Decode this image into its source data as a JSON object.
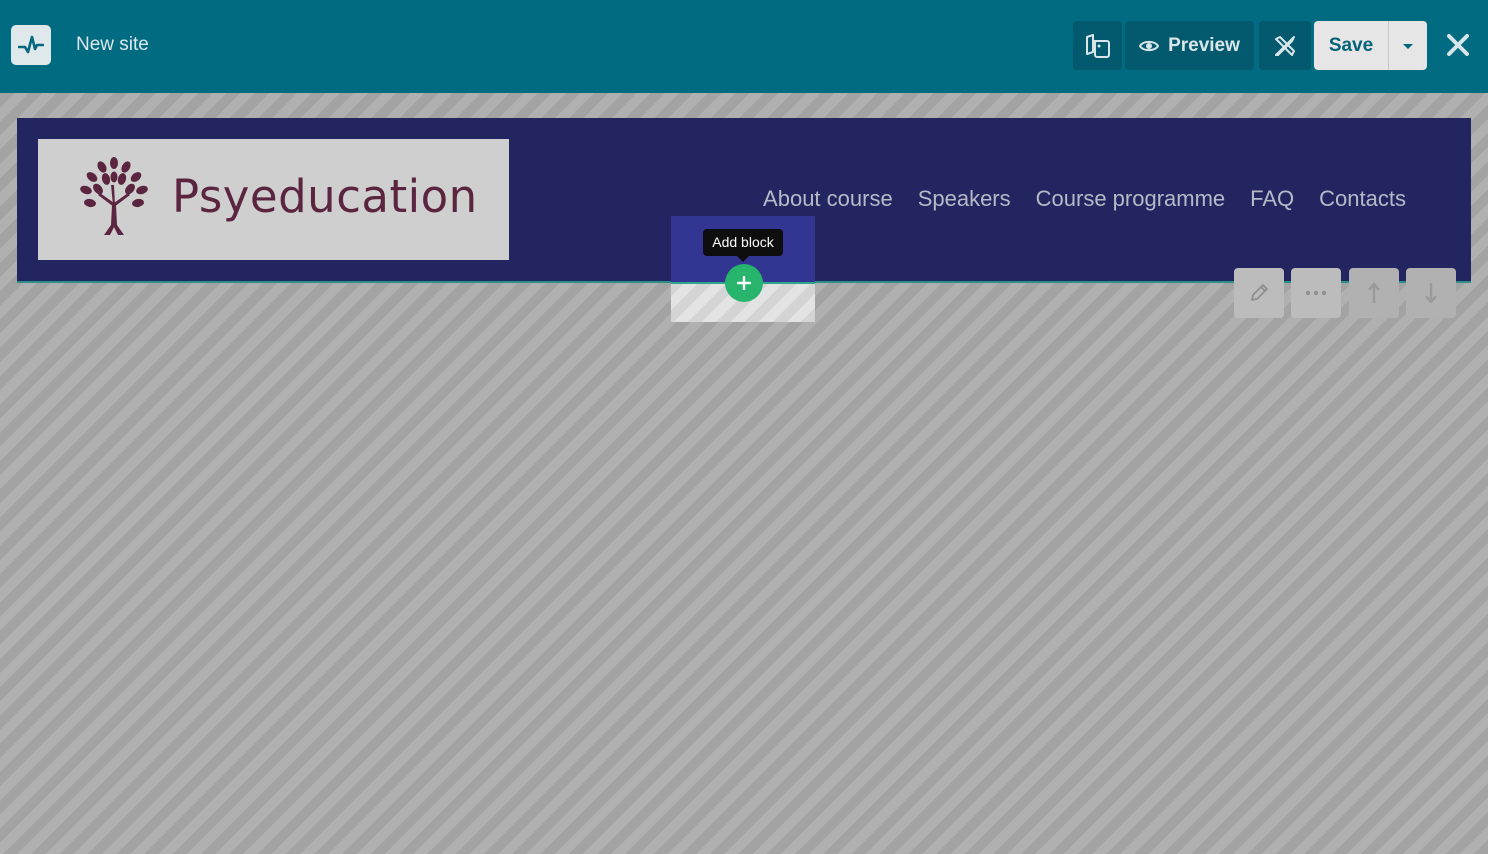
{
  "topbar": {
    "site_name": "New site",
    "preview_label": "Preview",
    "save_label": "Save",
    "icons": {
      "logo": "activity-pulse-icon",
      "pages": "pages-icon",
      "preview": "eye-icon",
      "design": "design-tools-icon",
      "save_menu": "caret-down-icon",
      "close": "close-icon"
    }
  },
  "site_header": {
    "brand_name": "Psyeducation",
    "nav": [
      "About course",
      "Speakers",
      "Course programme",
      "FAQ",
      "Contacts"
    ]
  },
  "add_block": {
    "tooltip": "Add block"
  },
  "block_tools": {
    "icons": [
      "pencil-icon",
      "more-dots-icon",
      "arrow-up-icon",
      "arrow-down-icon"
    ]
  },
  "colors": {
    "topbar": "#016b82",
    "header_bg": "#232561",
    "add_button": "#27b46d",
    "brand_text": "#5b2540"
  }
}
